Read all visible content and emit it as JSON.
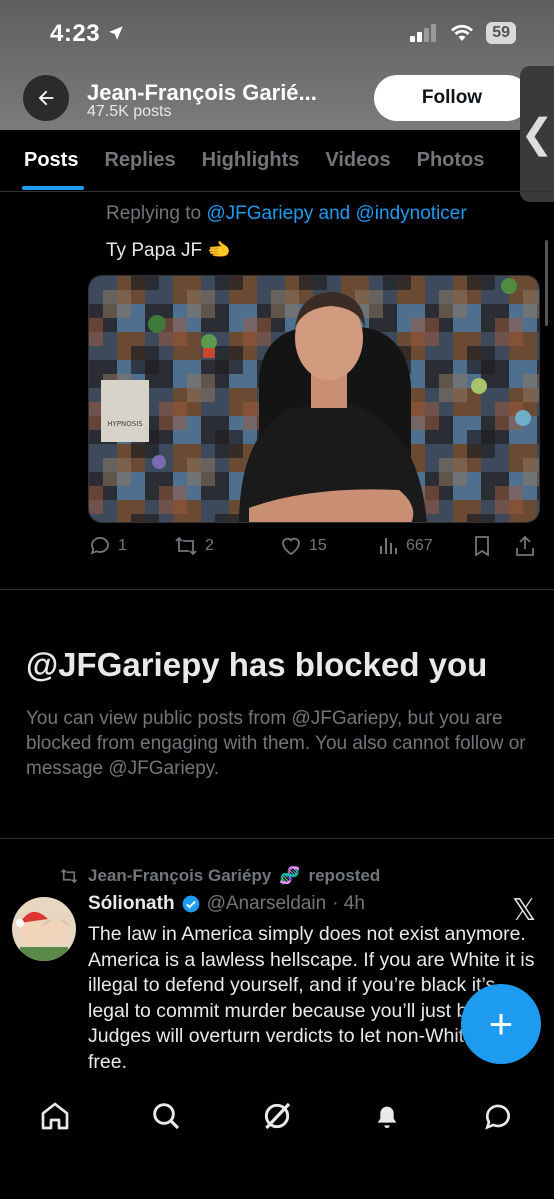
{
  "status_bar": {
    "time": "4:23",
    "battery": "59"
  },
  "header": {
    "name": "Jean-François Garié...",
    "posts_count": "47.5K posts",
    "follow_label": "Follow",
    "side_tab_glyph": "❮"
  },
  "tabs": [
    {
      "label": "Posts",
      "active": true
    },
    {
      "label": "Replies"
    },
    {
      "label": "Highlights"
    },
    {
      "label": "Videos"
    },
    {
      "label": "Photos"
    }
  ],
  "reply_tweet": {
    "replying_prefix": "Replying to",
    "replying_users": "@JFGariepy and @indynoticer",
    "text": "Ty Papa JF",
    "emoji": "🫲",
    "media": {
      "book_label": "HYPNOSIS"
    },
    "actions": {
      "replies": "1",
      "reposts": "2",
      "likes": "15",
      "views": "667"
    }
  },
  "blocked": {
    "title": "@JFGariepy has blocked you",
    "description": "You can view public posts from @JFGariepy, but you are blocked from engaging with them. You also cannot follow or message @JFGariepy."
  },
  "repost_tweet": {
    "reposted_by": "Jean-François Gariépy",
    "reposted_emoji": "🧬",
    "reposted_suffix": "reposted",
    "author_name": "Sólionath",
    "author_handle": "@Anarseldain",
    "time": "· 4h",
    "x_logo": "𝕏",
    "text": "The law in America simply does not exist anymore. America is a lawless hellscape. If you are White it is illegal to defend yourself, and if you’re black it’s legal to commit murder because you’ll just be let go. Judges will overturn verdicts to let non-Whites go free."
  },
  "fab_label": "+",
  "nav": [
    "home-icon",
    "search-icon",
    "grok-icon",
    "notifications-icon",
    "messages-icon"
  ],
  "colors": {
    "accent": "#1d9bf0",
    "muted": "#71767b",
    "text": "#e7e9ea",
    "background": "#000000"
  }
}
